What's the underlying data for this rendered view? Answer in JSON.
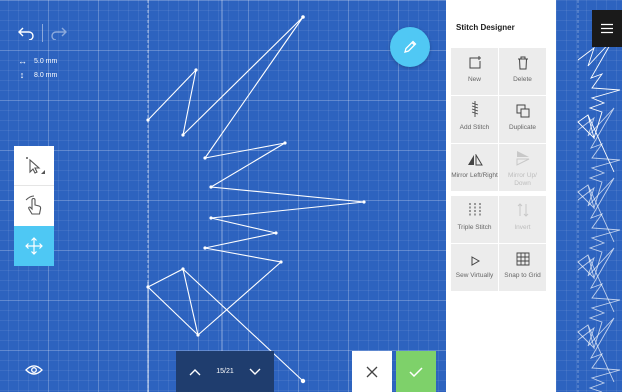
{
  "app": {
    "panel_title": "Stitch Designer",
    "accent_color": "#4ec8f4",
    "canvas_color": "#2d63bf",
    "confirm_color": "#7ed16a"
  },
  "canvas": {
    "width_label": "5.0 mm",
    "height_label": "8.0 mm",
    "width_icon": "horizontal-arrows-icon",
    "height_icon": "vertical-arrows-icon"
  },
  "toolbar": {
    "undo_icon": "undo-icon",
    "redo_icon": "redo-icon",
    "edit_icon": "pencil-icon",
    "tools": [
      {
        "name": "select-tool",
        "icon": "cursor-select-icon",
        "active": false
      },
      {
        "name": "touch-tool",
        "icon": "hand-pointer-icon",
        "active": false
      },
      {
        "name": "move-tool",
        "icon": "move-arrows-icon",
        "active": true
      }
    ]
  },
  "pager": {
    "current": 15,
    "total": 21,
    "label": "15/21"
  },
  "actions": {
    "cancel_icon": "close-icon",
    "confirm_icon": "check-icon",
    "view_icon": "eye-icon"
  },
  "designer": {
    "buttons": [
      {
        "label": "New",
        "icon": "new-stitch-icon",
        "enabled": true
      },
      {
        "label": "Delete",
        "icon": "trash-icon",
        "enabled": true
      },
      {
        "label": "Add Stitch",
        "icon": "add-stitch-icon",
        "enabled": true
      },
      {
        "label": "Duplicate",
        "icon": "duplicate-icon",
        "enabled": true
      },
      {
        "label": "Mirror Left/Right",
        "icon": "mirror-left-right-icon",
        "enabled": true
      },
      {
        "label": "Mirror Up/ Down",
        "icon": "mirror-up-down-icon",
        "enabled": false
      },
      {
        "label": "Triple Stitch",
        "icon": "triple-stitch-icon",
        "enabled": true
      },
      {
        "label": "Invert",
        "icon": "invert-icon",
        "enabled": false
      },
      {
        "label": "Sew Virtually",
        "icon": "play-icon",
        "enabled": true
      },
      {
        "label": "Snap to Grid",
        "icon": "snap-grid-icon",
        "enabled": true
      }
    ]
  },
  "menu": {
    "icon": "hamburger-menu-icon"
  }
}
